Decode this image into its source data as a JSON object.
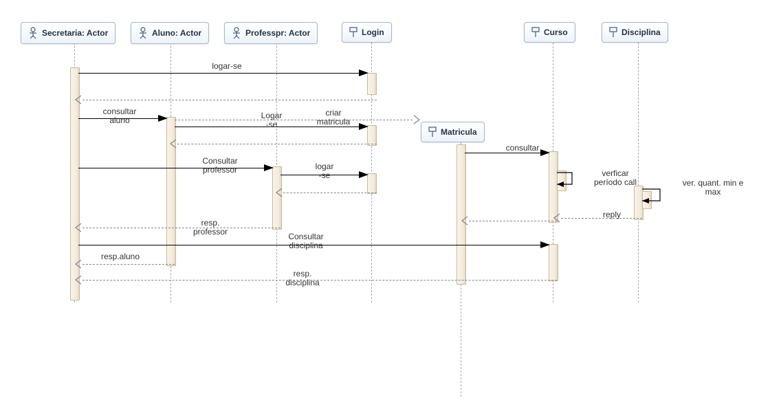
{
  "participants": {
    "secretaria": {
      "label": "Secretaria: Actor",
      "kind": "actor"
    },
    "aluno": {
      "label": "Aluno: Actor",
      "kind": "actor"
    },
    "professor": {
      "label": "Professpr: Actor",
      "kind": "actor"
    },
    "login": {
      "label": "Login",
      "kind": "object"
    },
    "matricula": {
      "label": "Matricula",
      "kind": "object"
    },
    "curso": {
      "label": "Curso",
      "kind": "object"
    },
    "disciplina": {
      "label": "Disciplina",
      "kind": "object"
    }
  },
  "messages": {
    "logar_se": "logar-se",
    "consultar_aluno": "consultar\naluno",
    "Logar_se": "Logar\n-se",
    "criar_matricula": "criar\nmatricula",
    "consultar_professor": "Consultar\nprofessor",
    "logar_se2": "logar\n-se",
    "consultar": "consultar",
    "verificar_per_call": "verficar\nperíodo call",
    "ver_quant_min_max": "ver. quant. min e\nmax",
    "reply": "reply",
    "resp_professor": "resp.\nprofessor",
    "consultar_disciplina": "Consultar\ndisciplina",
    "resp_aluno": "resp.aluno",
    "resp_disciplina": "resp.\ndisciplina"
  },
  "chart_data": {
    "type": "sequence-diagram",
    "participants": [
      {
        "id": "secretaria",
        "label": "Secretaria: Actor",
        "stereotype": "actor"
      },
      {
        "id": "aluno",
        "label": "Aluno: Actor",
        "stereotype": "actor"
      },
      {
        "id": "professor",
        "label": "Professpr: Actor",
        "stereotype": "actor"
      },
      {
        "id": "login",
        "label": "Login",
        "stereotype": "object"
      },
      {
        "id": "matricula",
        "label": "Matricula",
        "stereotype": "object",
        "created": true
      },
      {
        "id": "curso",
        "label": "Curso",
        "stereotype": "object"
      },
      {
        "id": "disciplina",
        "label": "Disciplina",
        "stereotype": "object"
      }
    ],
    "messages": [
      {
        "from": "secretaria",
        "to": "login",
        "label": "logar-se",
        "kind": "call"
      },
      {
        "from": "login",
        "to": "secretaria",
        "label": "",
        "kind": "return"
      },
      {
        "from": "secretaria",
        "to": "aluno",
        "label": "consultar aluno",
        "kind": "call"
      },
      {
        "from": "aluno",
        "to": "login",
        "label": "Logar-se",
        "kind": "call"
      },
      {
        "from": "aluno",
        "to": "matricula",
        "label": "criar matricula",
        "kind": "create"
      },
      {
        "from": "login",
        "to": "aluno",
        "label": "",
        "kind": "return"
      },
      {
        "from": "matricula",
        "to": "curso",
        "label": "consultar",
        "kind": "call"
      },
      {
        "from": "secretaria",
        "to": "professor",
        "label": "Consultar professor",
        "kind": "call"
      },
      {
        "from": "professor",
        "to": "login",
        "label": "logar-se",
        "kind": "call"
      },
      {
        "from": "curso",
        "to": "curso",
        "label": "verficar período call",
        "kind": "self"
      },
      {
        "from": "disciplina",
        "to": "disciplina",
        "label": "ver. quant. min e max",
        "kind": "self"
      },
      {
        "from": "login",
        "to": "professor",
        "label": "",
        "kind": "return"
      },
      {
        "from": "disciplina",
        "to": "curso",
        "label": "reply",
        "kind": "return"
      },
      {
        "from": "curso",
        "to": "matricula",
        "label": "",
        "kind": "return"
      },
      {
        "from": "professor",
        "to": "secretaria",
        "label": "resp. professor",
        "kind": "return"
      },
      {
        "from": "secretaria",
        "to": "curso",
        "label": "Consultar disciplina",
        "kind": "call"
      },
      {
        "from": "aluno",
        "to": "secretaria",
        "label": "resp.aluno",
        "kind": "return"
      },
      {
        "from": "curso",
        "to": "secretaria",
        "label": "resp. disciplina",
        "kind": "return"
      }
    ]
  }
}
